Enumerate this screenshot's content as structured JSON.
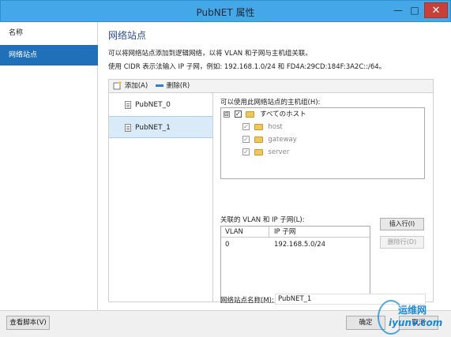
{
  "window": {
    "title": "PubNET 属性",
    "minimize": "—",
    "maximize": "□",
    "close": "✕"
  },
  "nav": {
    "items": [
      {
        "label": "名称"
      },
      {
        "label": "网络站点"
      }
    ],
    "selected_index": 1
  },
  "main": {
    "heading": "网络站点",
    "description1": "可以将网络站点添加到逻辑网络，以将 VLAN 和子网与主机组关联。",
    "description2": "使用 CIDR 表示法输入 IP 子网，例如: 192.168.1.0/24 和 FD4A:29CD:184F:3A2C::/64。"
  },
  "toolbar": {
    "add_label": "添加(A)",
    "remove_label": "删除(R)"
  },
  "sites": {
    "items": [
      {
        "label": "PubNET_0"
      },
      {
        "label": "PubNET_1"
      }
    ],
    "selected_index": 1
  },
  "hostgroups": {
    "label": "可以使用此网络站点的主机组(H):",
    "root": {
      "label": "すべてのホスト",
      "checked": true,
      "expander": "⊟"
    },
    "children": [
      {
        "label": "host",
        "checked": true
      },
      {
        "label": "gateway",
        "checked": true
      },
      {
        "label": "server",
        "checked": true
      }
    ]
  },
  "vlans": {
    "label": "关联的 VLAN 和 IP 子网(L):",
    "columns": [
      "VLAN",
      "IP 子网"
    ],
    "rows": [
      {
        "vlan": "0",
        "subnet": "192.168.5.0/24"
      }
    ],
    "insert_label": "插入行(I)",
    "delete_label": "删除行(D)"
  },
  "site_name": {
    "label": "网络站点名称(M):",
    "value": "PubNET_1"
  },
  "footer": {
    "view_script_label": "查看脚本(V)",
    "ok_label": "确定",
    "cancel_label": "取消"
  },
  "watermark": {
    "top": "运维网",
    "bottom": "iyunv.com"
  },
  "colors": {
    "titlebar": "#43a7e8",
    "selected_nav": "#1f70b8",
    "heading": "#2a4e8a",
    "selected_row": "#d9ebf9",
    "close": "#c7413a"
  }
}
